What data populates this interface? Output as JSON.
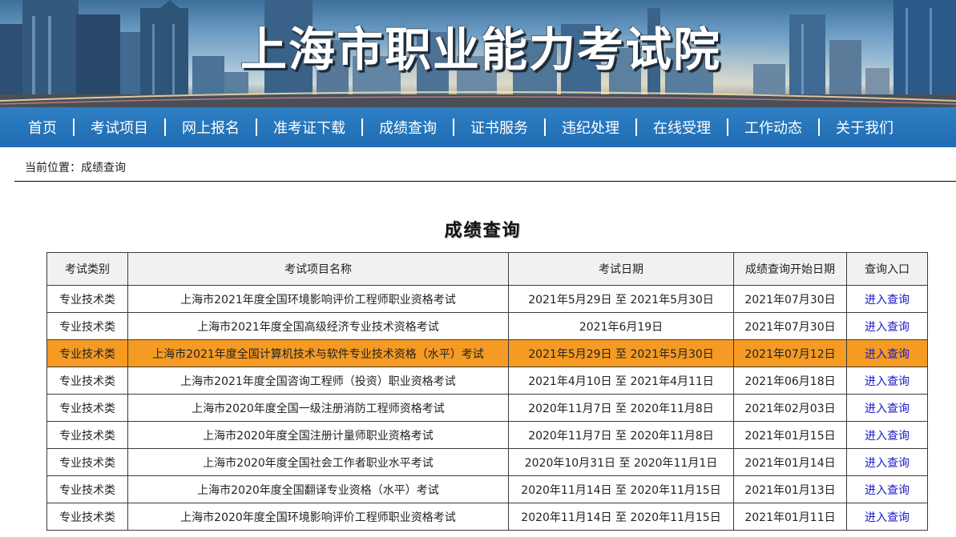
{
  "banner": {
    "title": "上海市职业能力考试院"
  },
  "nav": [
    "首页",
    "考试项目",
    "网上报名",
    "准考证下载",
    "成绩查询",
    "证书服务",
    "违纪处理",
    "在线受理",
    "工作动态",
    "关于我们"
  ],
  "breadcrumb": "当前位置：成绩查询",
  "page_title": "成绩查询",
  "table": {
    "headers": [
      "考试类别",
      "考试项目名称",
      "考试日期",
      "成绩查询开始日期",
      "查询入口"
    ],
    "rows": [
      [
        "专业技术类",
        "上海市2021年度全国环境影响评价工程师职业资格考试",
        "2021年5月29日 至 2021年5月30日",
        "2021年07月30日",
        "进入查询"
      ],
      [
        "专业技术类",
        "上海市2021年度全国高级经济专业技术资格考试",
        "2021年6月19日",
        "2021年07月30日",
        "进入查询"
      ],
      [
        "专业技术类",
        "上海市2021年度全国计算机技术与软件专业技术资格（水平）考试",
        "2021年5月29日 至 2021年5月30日",
        "2021年07月12日",
        "进入查询"
      ],
      [
        "专业技术类",
        "上海市2021年度全国咨询工程师（投资）职业资格考试",
        "2021年4月10日 至 2021年4月11日",
        "2021年06月18日",
        "进入查询"
      ],
      [
        "专业技术类",
        "上海市2020年度全国一级注册消防工程师资格考试",
        "2020年11月7日 至 2020年11月8日",
        "2021年02月03日",
        "进入查询"
      ],
      [
        "专业技术类",
        "上海市2020年度全国注册计量师职业资格考试",
        "2020年11月7日 至 2020年11月8日",
        "2021年01月15日",
        "进入查询"
      ],
      [
        "专业技术类",
        "上海市2020年度全国社会工作者职业水平考试",
        "2020年10月31日 至 2020年11月1日",
        "2021年01月14日",
        "进入查询"
      ],
      [
        "专业技术类",
        "上海市2020年度全国翻译专业资格（水平）考试",
        "2020年11月14日 至 2020年11月15日",
        "2021年01月13日",
        "进入查询"
      ],
      [
        "专业技术类",
        "上海市2020年度全国环境影响评价工程师职业资格考试",
        "2020年11月14日 至 2020年11月15日",
        "2021年01月11日",
        "进入查询"
      ]
    ],
    "highlighted_row": 2
  },
  "colors": {
    "nav_bg": "#1f6cb3",
    "highlight_row": "#f59a23",
    "link": "#1a1ac8"
  }
}
